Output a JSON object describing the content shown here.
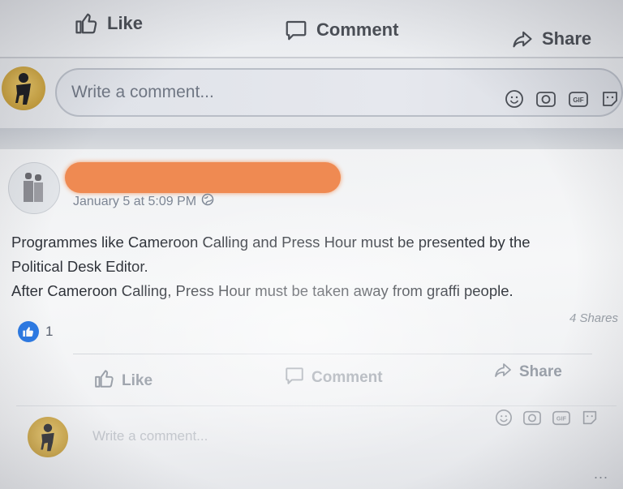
{
  "top_actions": {
    "like_label": "Like",
    "comment_label": "Comment",
    "share_label": "Share"
  },
  "composer_top": {
    "placeholder": "Write a comment...",
    "icons": [
      "emoji-icon",
      "camera-icon",
      "gif-icon",
      "sticker-icon"
    ]
  },
  "post": {
    "timestamp": "January 5 at 5:09 PM",
    "privacy_icon": "globe-icon",
    "text_lines": [
      "Programmes like Cameroon Calling and Press Hour must be presented by the",
      "Political Desk Editor.",
      "After Cameroon Calling, Press Hour must be taken away from graffi people."
    ],
    "reaction_count": "1",
    "shares": "4 Shares",
    "actions": {
      "like_label": "Like",
      "comment_label": "Comment",
      "share_label": "Share"
    }
  },
  "composer_bottom": {
    "placeholder": "Write a comment..."
  },
  "more_label": "...",
  "colors": {
    "redaction": "#ef8a52",
    "like_blue": "#2d7be5",
    "avatar_gold": "#c8a03d"
  }
}
